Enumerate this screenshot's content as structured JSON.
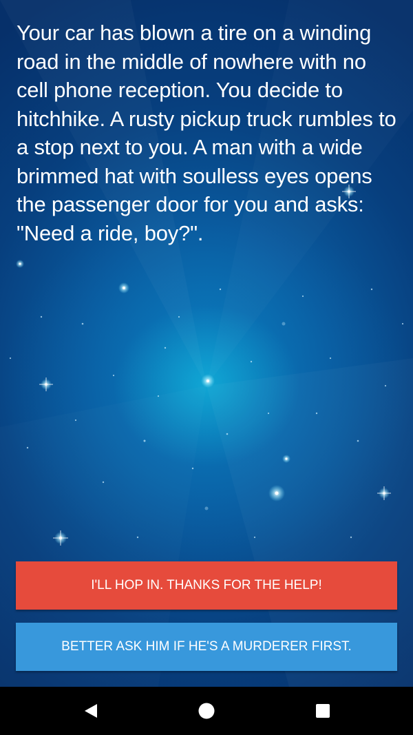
{
  "story": {
    "text": "Your car has blown a tire on a winding road in the middle of nowhere with no cell phone reception. You decide to hitchhike. A rusty pickup truck rumbles to a stop next to you. A man with a wide brimmed hat with soulless eyes opens the passenger door for you and asks: \"Need a ride, boy?\"."
  },
  "choices": [
    {
      "label": "I'll hop in. Thanks for the help!",
      "color": "#e64b3c"
    },
    {
      "label": "Better ask him if he's a murderer first.",
      "color": "#3898dc"
    }
  ],
  "navbar": {
    "back_icon": "triangle-back-icon",
    "home_icon": "circle-home-icon",
    "recent_icon": "square-recent-apps-icon"
  },
  "colors": {
    "background_top": "#06306a",
    "background_center": "#0b7fc0",
    "text": "#ffffff",
    "navbar": "#000000"
  }
}
